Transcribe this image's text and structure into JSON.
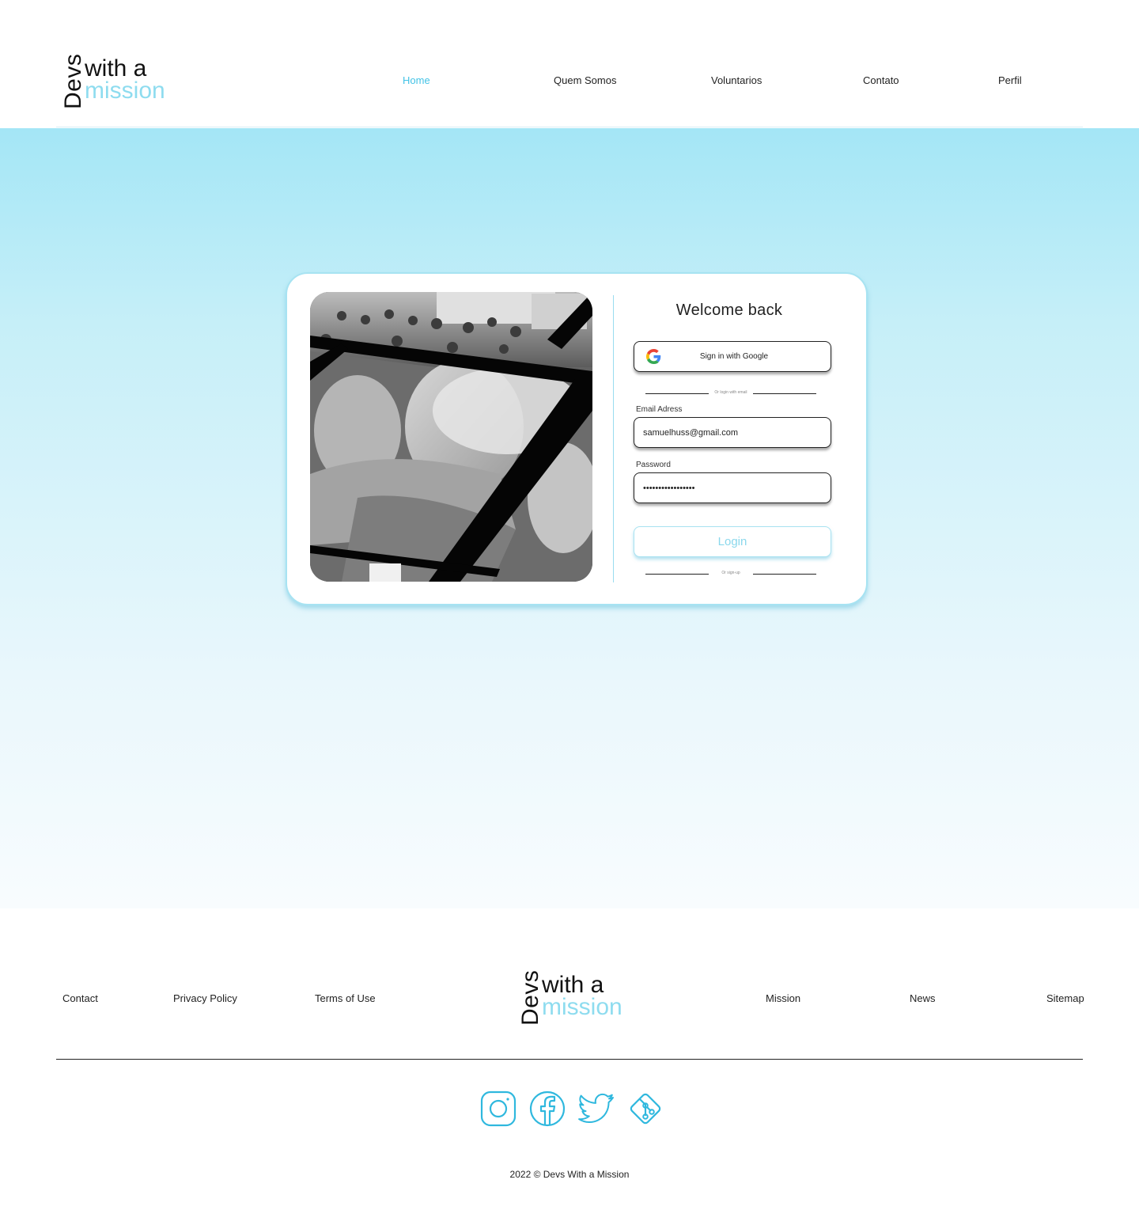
{
  "header": {
    "logo": {
      "devs": "Devs",
      "with": "with a",
      "mission": "mission"
    },
    "nav": [
      {
        "label": "Home",
        "active": true
      },
      {
        "label": "Quem Somos",
        "active": false
      },
      {
        "label": "Voluntarios",
        "active": false
      },
      {
        "label": "Contato",
        "active": false
      },
      {
        "label": "Perfil",
        "active": false
      }
    ]
  },
  "login": {
    "title": "Welcome back",
    "google_label": "Sign in with Google",
    "or_email": "Or login with email",
    "email_label": "Email Adress",
    "email_value": "samuelhuss@gmail.com",
    "password_label": "Password",
    "password_value": "•••••••••••••••••",
    "login_label": "Login",
    "or_signup": "Or sign-up"
  },
  "footer": {
    "left_links": [
      "Contact",
      "Privacy Policy",
      "Terms of Use"
    ],
    "right_links": [
      "Mission",
      "News",
      "Sitemap"
    ],
    "logo": {
      "devs": "Devs",
      "with": "with a",
      "mission": "mission"
    },
    "social": [
      "instagram-icon",
      "facebook-icon",
      "twitter-icon",
      "git-icon"
    ],
    "copyright": "2022 © Devs With a Mission"
  },
  "colors": {
    "accent": "#43c3e6",
    "accent_light": "#8edcef",
    "card_border": "#a7e3f2"
  }
}
